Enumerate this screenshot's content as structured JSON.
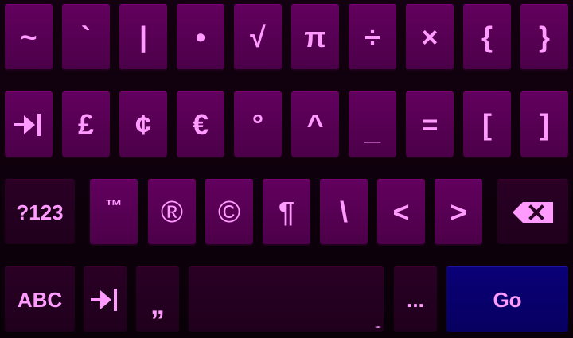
{
  "keyboard": {
    "row1": [
      "~",
      "`",
      "|",
      "•",
      "√",
      "π",
      "÷",
      "×",
      "{",
      "}"
    ],
    "row2": {
      "tab_icon": "tab-icon",
      "keys": [
        "£",
        "¢",
        "€",
        "°",
        "^",
        "_",
        "=",
        "[",
        "]"
      ]
    },
    "row3": {
      "mode_label": "?123",
      "keys": [
        "™",
        "®",
        "©",
        "¶",
        "\\",
        "<",
        ">"
      ],
      "backspace_icon": "backspace-icon"
    },
    "row4": {
      "abc_label": "ABC",
      "tab_icon": "tab-icon",
      "quote": "„",
      "space_hint": "...",
      "ellipsis": "...",
      "go_label": "Go"
    },
    "colors": {
      "key_fill": "#5a0056",
      "func_fill": "#250021",
      "glyph": "#ff9bff",
      "go_fill": "#08006c",
      "background": "#0e000b"
    }
  }
}
